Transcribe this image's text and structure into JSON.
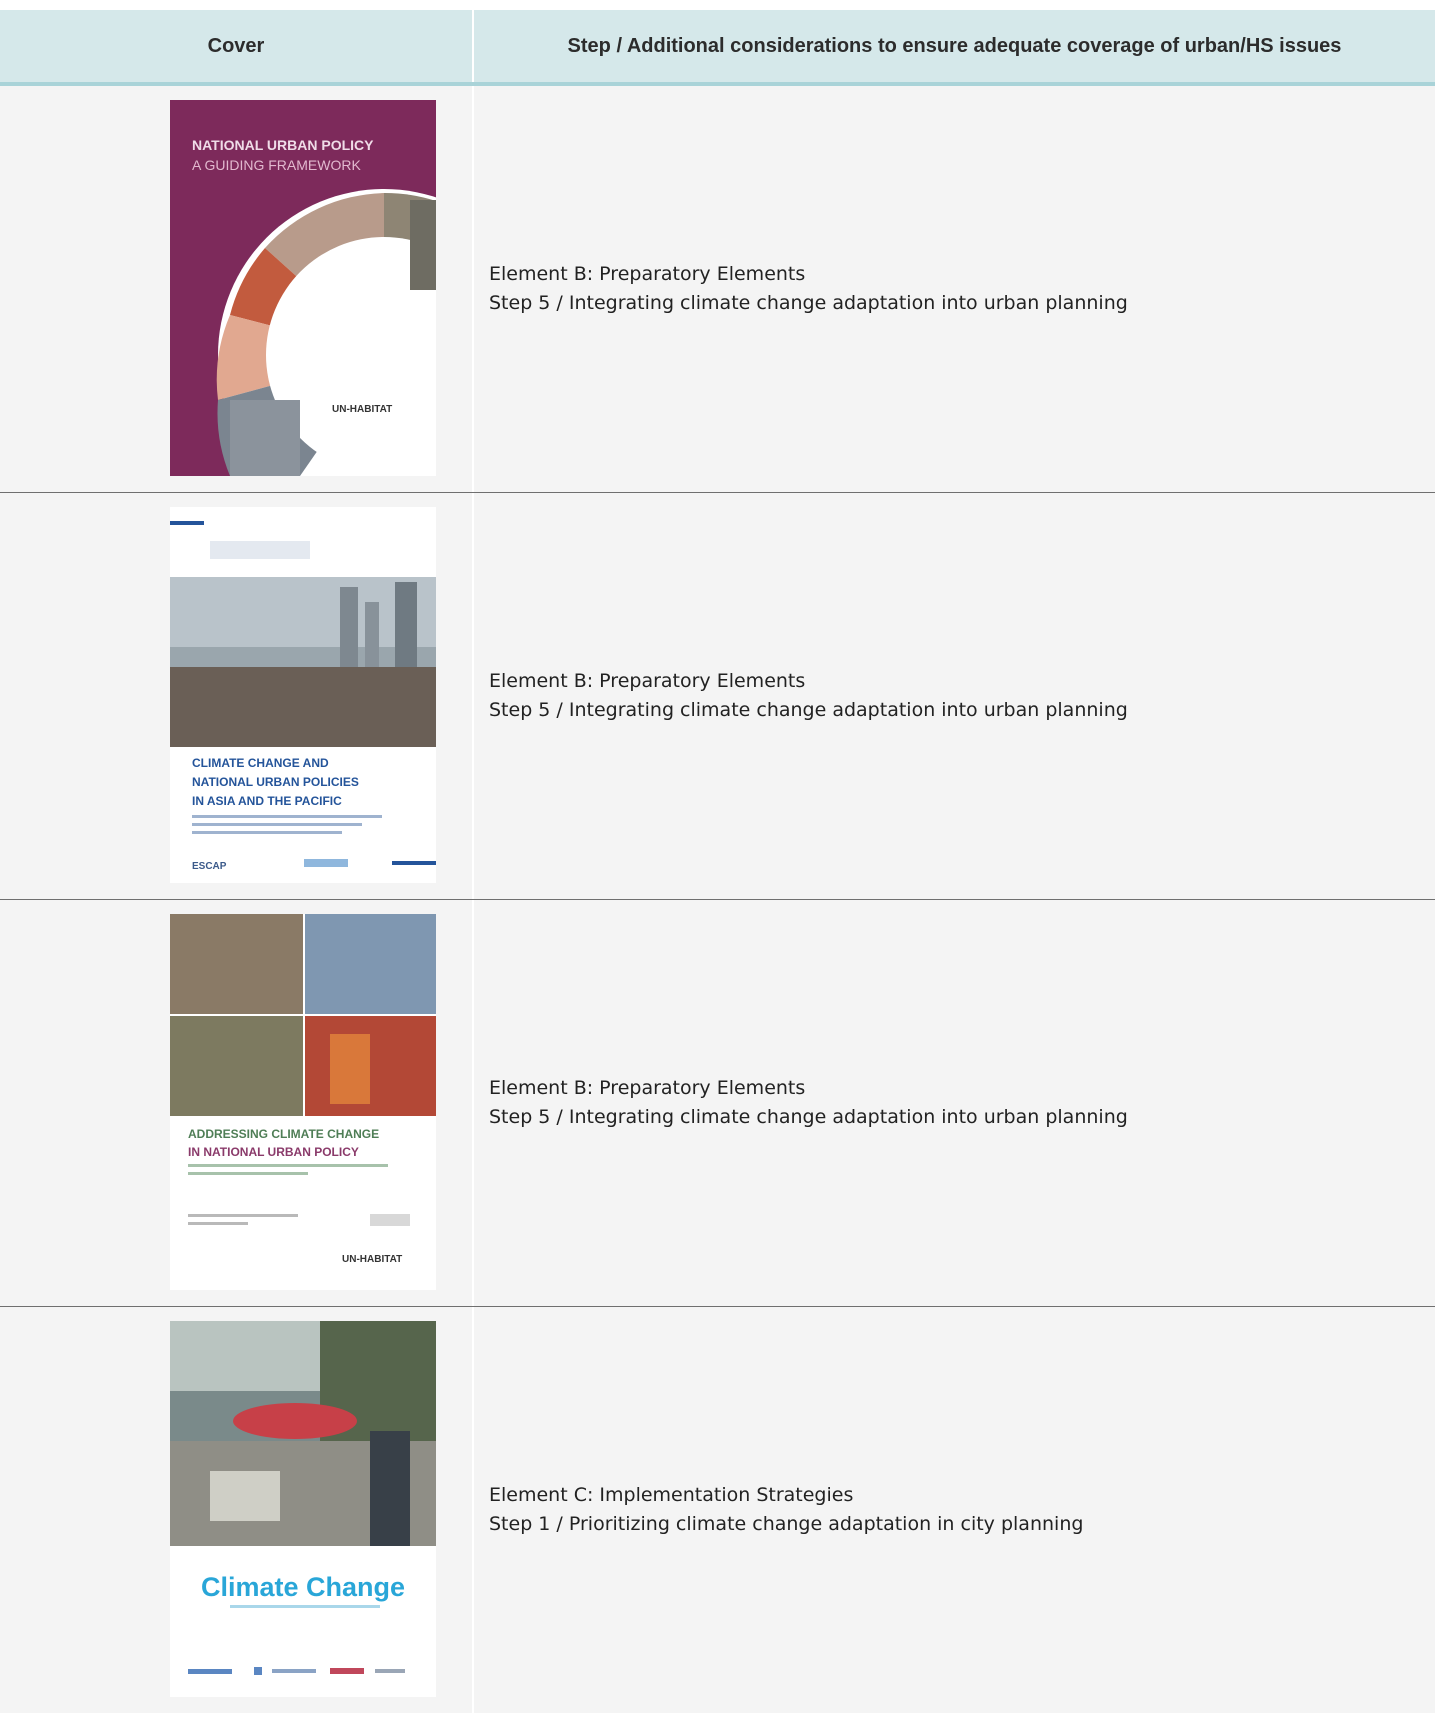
{
  "table": {
    "headers": {
      "cover": "Cover",
      "step": "Step / Additional considerations to ensure adequate coverage of urban/HS issues"
    },
    "rows": [
      {
        "cover_name": "national-urban-policy-cover",
        "cover_title_1": "NATIONAL URBAN POLICY",
        "cover_title_2": "A GUIDING FRAMEWORK",
        "cover_logo": "UN-HABITAT",
        "element": "Element B: Preparatory Elements",
        "step": "Step 5 / Integrating climate change adaptation into urban planning"
      },
      {
        "cover_name": "climate-change-nup-asia-pacific-cover",
        "cover_title_1": "CLIMATE CHANGE AND",
        "cover_title_2": "NATIONAL URBAN POLICIES",
        "cover_title_3": "IN ASIA AND THE PACIFIC",
        "cover_logo": "ESCAP",
        "element": "Element B: Preparatory Elements",
        "step": "Step 5 / Integrating climate change adaptation into urban planning"
      },
      {
        "cover_name": "addressing-climate-change-nup-cover",
        "cover_title_1": "ADDRESSING CLIMATE CHANGE",
        "cover_title_2": "IN NATIONAL URBAN POLICY",
        "cover_logo": "UN-HABITAT",
        "element": "Element B: Preparatory Elements",
        "step": "Step 5 / Integrating climate change adaptation into urban planning"
      },
      {
        "cover_name": "climate-change-city-planning-cover",
        "cover_title_1": "Climate Change",
        "element": "Element C: Implementation Strategies",
        "step": "Step 1 / Prioritizing climate change adaptation in city planning"
      }
    ]
  },
  "colors": {
    "header_bg": "#d5e8ea",
    "header_rule": "#a9d3d8",
    "row_bg": "#f4f4f4",
    "cover1_purple": "#7d2a5b",
    "cover2_blue": "#24549a",
    "cover3_green": "#4f7e56",
    "cover4_cyan": "#29a6d8"
  }
}
